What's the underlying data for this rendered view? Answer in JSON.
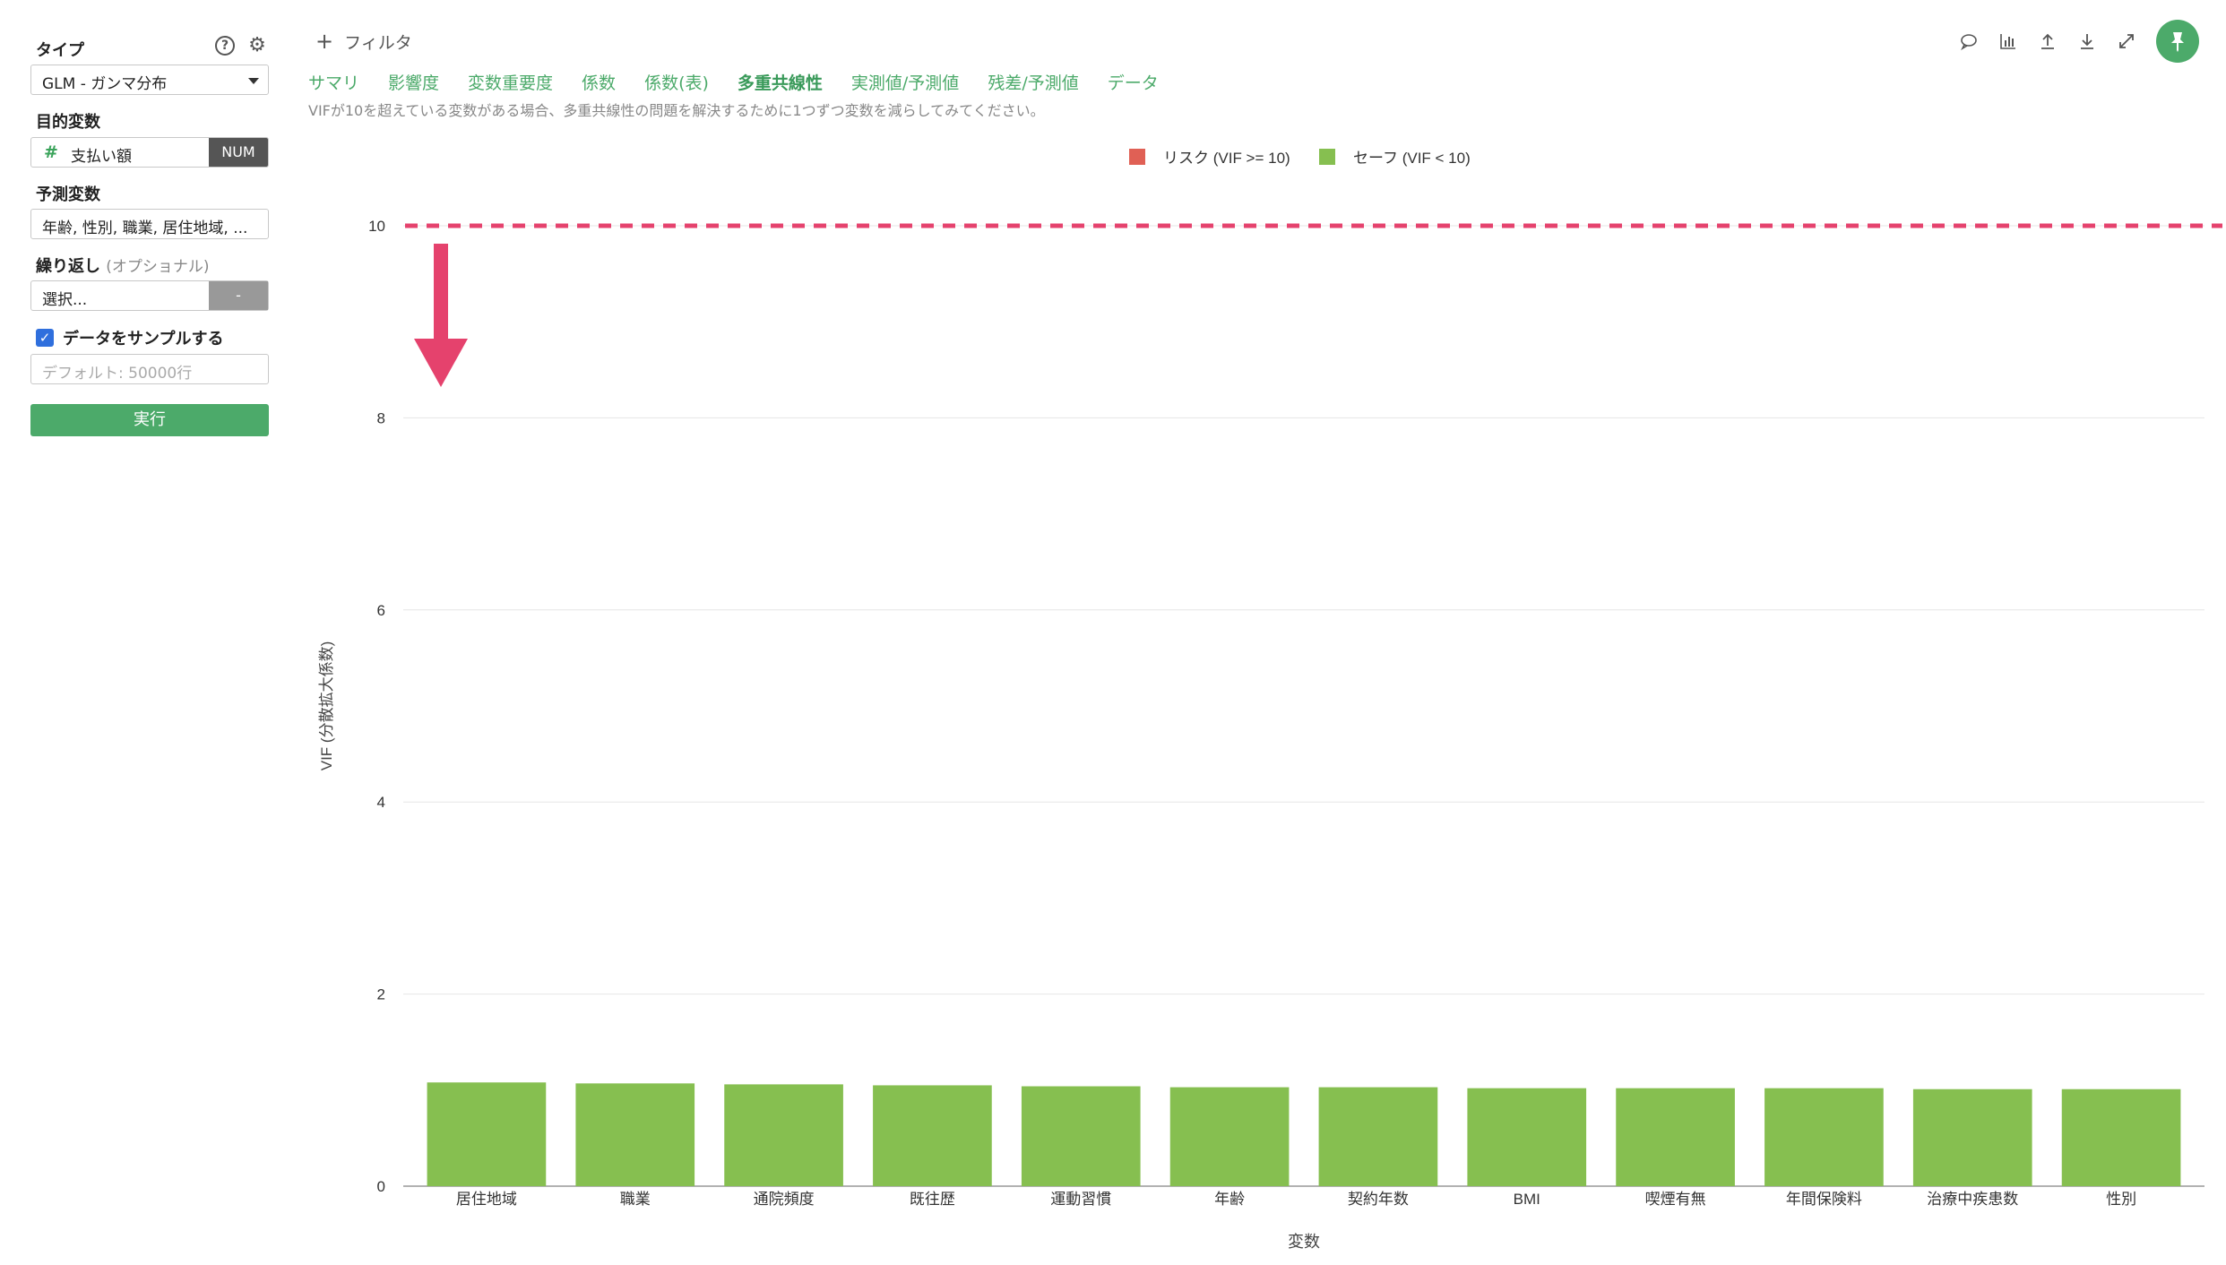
{
  "sidebar": {
    "type_label": "タイプ",
    "help_icon": "?",
    "gear_icon": "⚙",
    "type_value": "GLM - ガンマ分布",
    "target_label": "目的変数",
    "target_hash": "#",
    "target_value": "支払い額",
    "target_type": "NUM",
    "predictors_label": "予測変数",
    "predictors_value": "年齢, 性別, 職業, 居住地域, ...",
    "repeat_label": "繰り返し",
    "repeat_optional": "(オプショナル)",
    "repeat_value": "選択...",
    "repeat_dash": "-",
    "sample_label": "データをサンプルする",
    "sample_checked": true,
    "sample_placeholder": "デフォルト: 50000行",
    "run_label": "実行"
  },
  "header": {
    "filter_label": "フィルタ",
    "tabs": [
      {
        "label": "サマリ",
        "active": false
      },
      {
        "label": "影響度",
        "active": false
      },
      {
        "label": "変数重要度",
        "active": false
      },
      {
        "label": "係数",
        "active": false
      },
      {
        "label": "係数(表)",
        "active": false
      },
      {
        "label": "多重共線性",
        "active": true
      },
      {
        "label": "実測値/予測値",
        "active": false
      },
      {
        "label": "残差/予測値",
        "active": false
      },
      {
        "label": "データ",
        "active": false
      }
    ],
    "notice": "VIFが10を超えている変数がある場合、多重共線性の問題を解決するために1つずつ変数を減らしてみてください。",
    "toolbar_icons": [
      "comment-icon",
      "chart-icon",
      "upload-icon",
      "download-icon",
      "expand-icon",
      "pin-icon"
    ]
  },
  "chart_data": {
    "type": "bar",
    "xlabel": "変数",
    "ylabel": "VIF (分散拡大係数)",
    "ylim": [
      0,
      10
    ],
    "yticks": [
      0,
      2,
      4,
      6,
      8,
      10
    ],
    "threshold": 10,
    "legend": [
      {
        "name": "リスク (VIF >= 10)",
        "color": "#e06055"
      },
      {
        "name": "セーフ (VIF < 10)",
        "color": "#86bf50"
      }
    ],
    "legend_position": "top-center",
    "categories": [
      "居住地域",
      "職業",
      "通院頻度",
      "既往歴",
      "運動習慣",
      "年齢",
      "契約年数",
      "BMI",
      "喫煙有無",
      "年間保険料",
      "治療中疾患数",
      "性別"
    ],
    "values": [
      1.08,
      1.07,
      1.06,
      1.05,
      1.04,
      1.03,
      1.03,
      1.02,
      1.02,
      1.02,
      1.01,
      1.01
    ],
    "bar_color": "#86bf50",
    "threshold_color": "#e5426d",
    "arrow_color": "#e5426d"
  }
}
